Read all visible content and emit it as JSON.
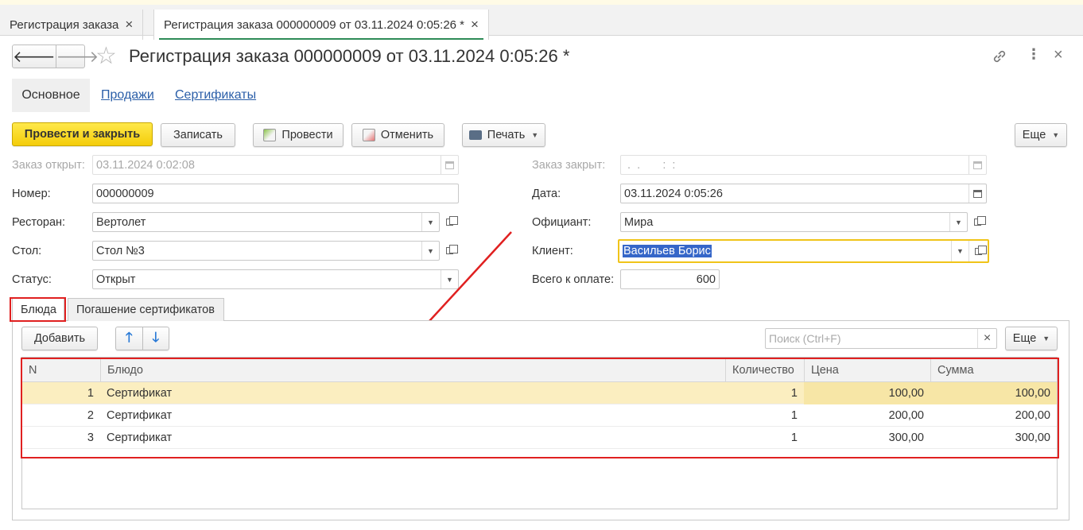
{
  "tabs": [
    {
      "label": "Регистрация заказа",
      "close": "×"
    },
    {
      "label": "Регистрация заказа 000000009 от 03.11.2024 0:05:26 *",
      "close": "×"
    }
  ],
  "header": {
    "back": "🡐",
    "forward": "🡒",
    "star": "☆",
    "title": "Регистрация заказа 000000009 от 03.11.2024 0:05:26 *",
    "link_icon": "🔗",
    "more_icon": "⋮",
    "close_icon": "×"
  },
  "sections": {
    "main": "Основное",
    "sales": "Продажи",
    "certs": "Сертификаты"
  },
  "toolbar": {
    "post_close": "Провести и закрыть",
    "save": "Записать",
    "post": "Провести",
    "cancel": "Отменить",
    "print": "Печать",
    "more": "Еще"
  },
  "form": {
    "opened_label": "Заказ открыт:",
    "opened_value": "03.11.2024  0:02:08",
    "closed_label": "Заказ закрыт:",
    "closed_value": " .  .       :  :",
    "number_label": "Номер:",
    "number_value": "000000009",
    "date_label": "Дата:",
    "date_value": "03.11.2024  0:05:26",
    "restaurant_label": "Ресторан:",
    "restaurant_value": "Вертолет",
    "waiter_label": "Официант:",
    "waiter_value": "Мира",
    "table_label": "Стол:",
    "table_value": "Стол №3",
    "client_label": "Клиент:",
    "client_value": "Васильев Борис",
    "status_label": "Статус:",
    "status_value": "Открыт",
    "total_label": "Всего к оплате:",
    "total_value": "600"
  },
  "inner_tabs": {
    "dishes": "Блюда",
    "cert_redeem": "Погашение сертификатов"
  },
  "list_toolbar": {
    "add": "Добавить",
    "up": "🡑",
    "down": "🡓",
    "search_placeholder": "Поиск (Ctrl+F)",
    "clear": "×",
    "more": "Еще"
  },
  "table": {
    "columns": [
      "N",
      "Блюдо",
      "Количество",
      "Цена",
      "Сумма"
    ],
    "rows": [
      {
        "n": "1",
        "dish": "Сертификат",
        "qty": "1",
        "price": "100,00",
        "sum": "100,00"
      },
      {
        "n": "2",
        "dish": "Сертификат",
        "qty": "1",
        "price": "200,00",
        "sum": "200,00"
      },
      {
        "n": "3",
        "dish": "Сертификат",
        "qty": "1",
        "price": "300,00",
        "sum": "300,00"
      }
    ]
  }
}
